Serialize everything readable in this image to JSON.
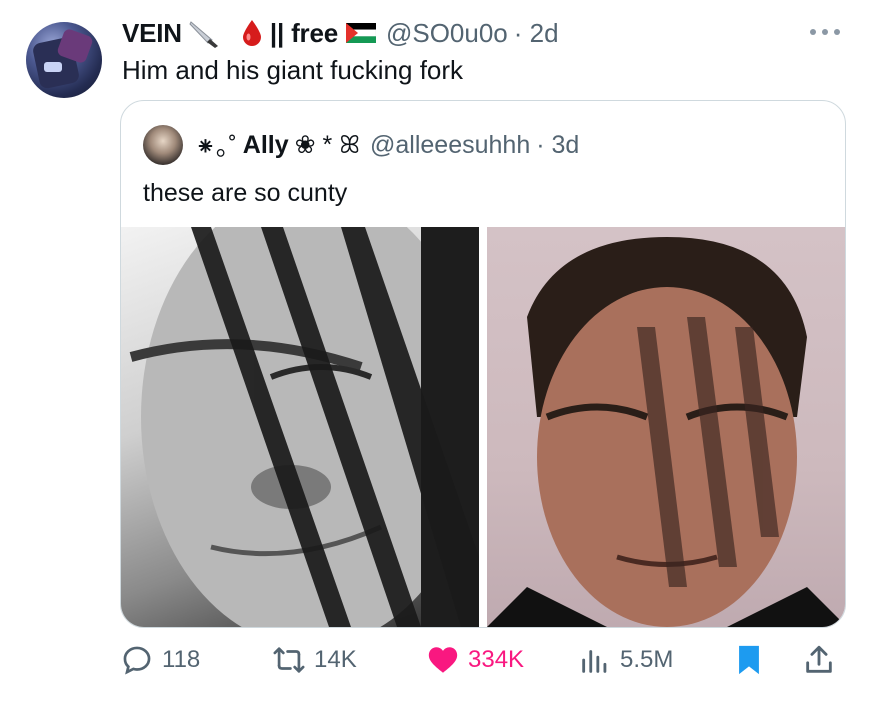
{
  "tweet": {
    "author_name": "VEIN",
    "name_suffix": "|| free",
    "handle": "@SO0u0o",
    "time": "· 2d",
    "text": "Him and his giant fucking fork"
  },
  "quote": {
    "name_prefix": "⁕｡˚",
    "author_name": "Ally",
    "name_suffix": "❀ * ꕤ",
    "handle": "@alleeesuhhh",
    "time": "· 3d",
    "text": "these are so cunty"
  },
  "actions": {
    "replies": "118",
    "reposts": "14K",
    "likes": "334K",
    "views": "5.5M"
  },
  "icons": {
    "avatar": "user-avatar",
    "knife": "knife-emoji-icon",
    "drop": "blood-drop-emoji-icon",
    "flag": "palestine-flag-icon",
    "more": "more-options-icon",
    "reply": "reply-icon",
    "repost": "repost-icon",
    "like": "heart-icon",
    "views": "views-chart-icon",
    "bookmark": "bookmark-icon",
    "share": "share-icon"
  },
  "colors": {
    "like": "#f91880",
    "bookmark": "#1d9bf0",
    "secondary_text": "#536471",
    "border": "#cfd9de"
  }
}
